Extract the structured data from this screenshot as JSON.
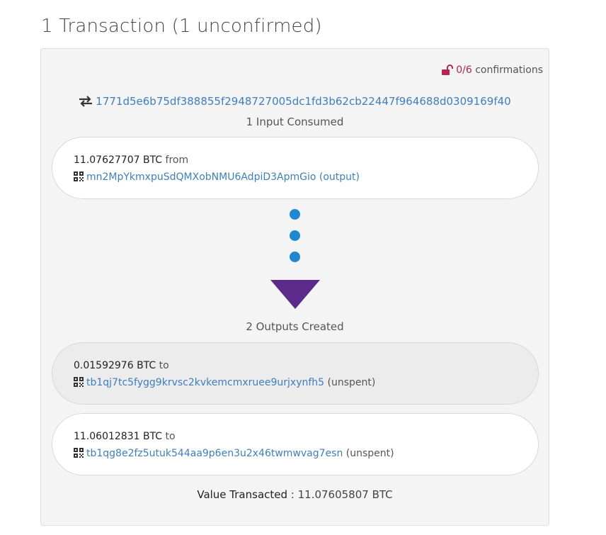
{
  "page": {
    "title": "1 Transaction (1 unconfirmed)"
  },
  "transaction": {
    "confirmations": {
      "count": "0/6",
      "label": " confirmations"
    },
    "txid": "1771d5e6b75df388855f2948727005dc1fd3b62cb22447f964688d0309169f40",
    "inputs_label": "1 Input Consumed",
    "inputs": [
      {
        "amount": "11.07627707 BTC",
        "direction": " from",
        "address": "mn2MpYkmxpuSdQMXobNMU6AdpiD3ApmGio",
        "link_suffix": " (output)"
      }
    ],
    "outputs_label": "2 Outputs Created",
    "outputs": [
      {
        "amount": "0.01592976 BTC",
        "direction": " to",
        "address": "tb1qj7tc5fygg9krvsc2kvkemcmxruee9urjxynfh5",
        "status": " (unspent)"
      },
      {
        "amount": "11.06012831 BTC",
        "direction": " to",
        "address": "tb1qg8e2fz5utuk544aa9p6en3u2x46twmwvag7esn",
        "status": " (unspent)"
      }
    ],
    "total": {
      "label": "Value Transacted",
      "separator": " : ",
      "value": "11.07605807 BTC"
    }
  },
  "colors": {
    "link": "#3e7fbf",
    "dot": "#1e88d0",
    "arrow": "#5b2a8a",
    "lock": "#b5254d"
  },
  "icons": [
    "unlocked-lock-icon",
    "exchange-arrows-icon",
    "qr-code-icon",
    "flow-dot-icon",
    "down-triangle-arrow-icon"
  ]
}
